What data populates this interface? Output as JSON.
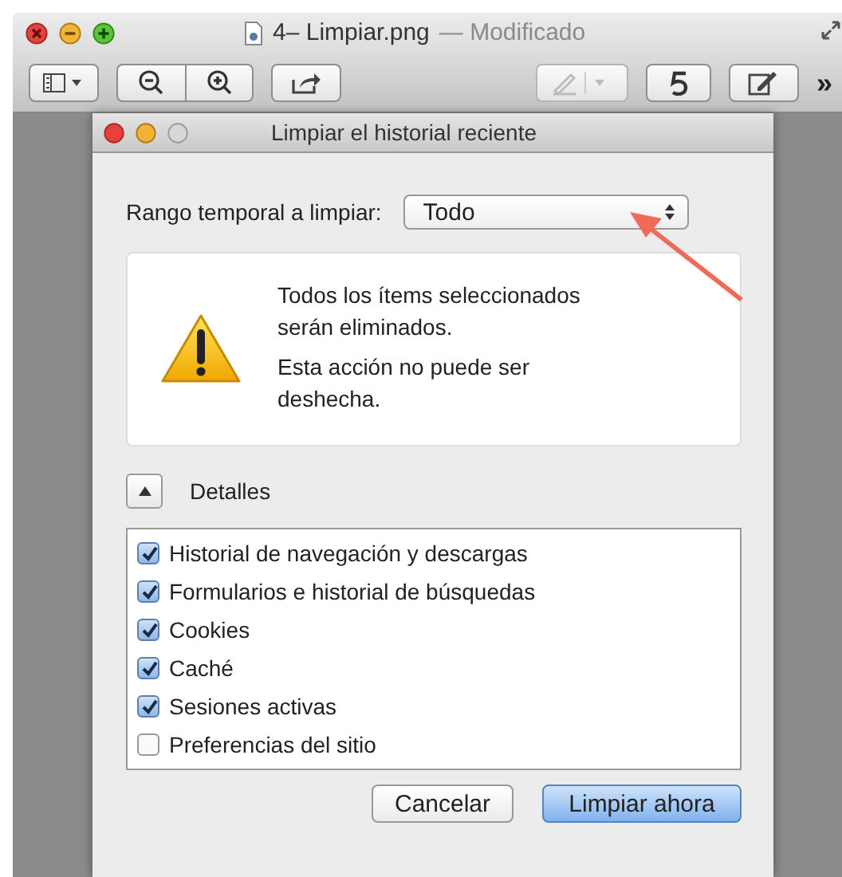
{
  "window": {
    "title": "4– Limpiar.png",
    "status": "— Modificado"
  },
  "toolbar": {
    "overflow": "»"
  },
  "dialog": {
    "title": "Limpiar el historial reciente",
    "range": {
      "label": "Rango temporal a limpiar:",
      "value": "Todo"
    },
    "warning": [
      "Todos los ítems seleccionados serán eliminados.",
      "Esta acción no puede ser deshecha."
    ],
    "details": {
      "label": "Detalles",
      "expanded": true
    },
    "items": [
      {
        "label": "Historial de navegación y descargas",
        "checked": true
      },
      {
        "label": "Formularios e historial de búsquedas",
        "checked": true
      },
      {
        "label": "Cookies",
        "checked": true
      },
      {
        "label": "Caché",
        "checked": true
      },
      {
        "label": "Sesiones activas",
        "checked": true
      },
      {
        "label": "Preferencias del sitio",
        "checked": false
      }
    ],
    "buttons": [
      {
        "label": "Cancelar",
        "kind": "normal"
      },
      {
        "label": "Limpiar ahora",
        "kind": "default"
      }
    ]
  }
}
